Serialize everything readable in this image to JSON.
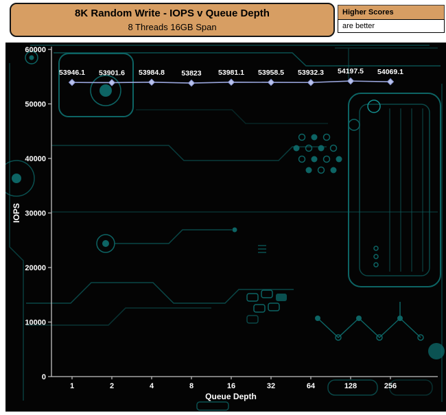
{
  "header": {
    "title": "8K Random Write - IOPS v Queue Depth",
    "subtitle": "8 Threads 16GB Span",
    "legend": {
      "higher_scores": "Higher Scores",
      "are_better": "are better"
    }
  },
  "chart_data": {
    "type": "line",
    "title": "8K Random Write - IOPS v Queue Depth",
    "subtitle": "8 Threads 16GB Span",
    "xlabel": "Queue Depth",
    "ylabel": "IOPS",
    "categories": [
      "1",
      "2",
      "4",
      "8",
      "16",
      "32",
      "64",
      "128",
      "256"
    ],
    "series": [
      {
        "name": "IOPS",
        "values": [
          53946.1,
          53901.6,
          53984.8,
          53823,
          53981.1,
          53958.5,
          53932.3,
          54197.5,
          54069.1
        ]
      }
    ],
    "labels": [
      "53946.1",
      "53901.6",
      "53984.8",
      "53823",
      "53981.1",
      "53958.5",
      "53932.3",
      "54197.5",
      "54069.1"
    ],
    "ylim": [
      0,
      60000
    ],
    "ytick_interval": 10000,
    "ytick_labels": [
      "0",
      "10000",
      "20000",
      "30000",
      "40000",
      "50000",
      "60000"
    ],
    "grid": false,
    "legend_position": "top-right",
    "marker": "diamond",
    "line_color": "#9aa6dd",
    "marker_fill": "#b8c2ec",
    "marker_stroke": "#8a96d2"
  },
  "colors": {
    "banner_bg": "#d79e63",
    "chart_bg": "#040404",
    "circuit": "#0d6464",
    "axis": "#c4c4c4",
    "tick_text": "#ffffff"
  }
}
